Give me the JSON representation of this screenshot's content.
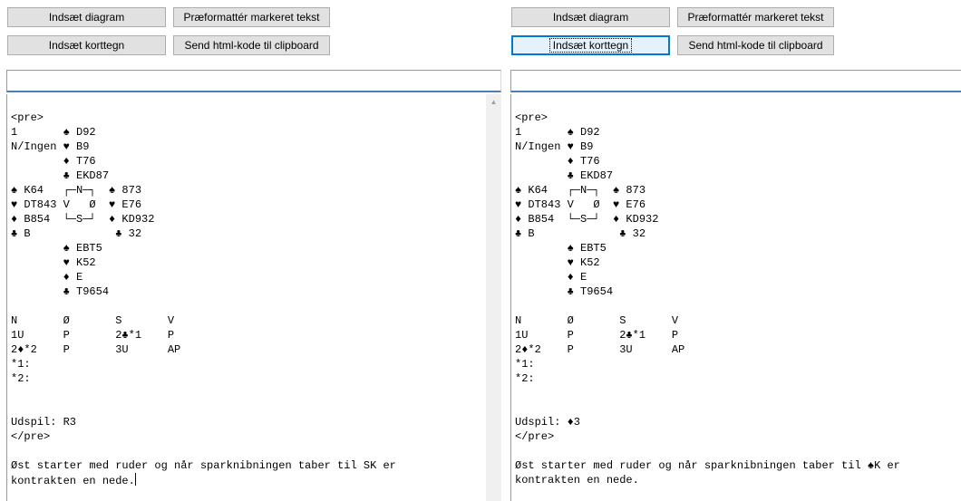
{
  "left": {
    "buttons": {
      "insert_diagram": "Indsæt diagram",
      "preformat_selected": "Præformattér markeret tekst",
      "insert_card_symbol": "Indsæt korttegn",
      "send_html": "Send html-kode til clipboard"
    },
    "input_value": "",
    "content": "<pre>\n1       ♠ D92\nN/Ingen ♥ B9\n        ♦ T76\n        ♣ EKD87\n♠ K64   ┌─N─┐  ♠ 873\n♥ DT843 V   Ø  ♥ E76\n♦ B854  └─S─┘  ♦ KD932\n♣ B             ♣ 32\n        ♠ EBT5\n        ♥ K52\n        ♦ E\n        ♣ T9654\n\nN       Ø       S       V\n1U      P       2♣*1    P\n2♦*2    P       3U      AP\n*1:\n*2:\n\n\nUdspil: R3\n</pre>\n\nØst starter med ruder og når sparknibningen taber til SK er\nkontrakten en nede."
  },
  "right": {
    "buttons": {
      "insert_diagram": "Indsæt diagram",
      "preformat_selected": "Præformattér markeret tekst",
      "insert_card_symbol": "Indsæt korttegn",
      "send_html": "Send html-kode til clipboard"
    },
    "input_value": "",
    "content": "<pre>\n1       ♠ D92\nN/Ingen ♥ B9\n        ♦ T76\n        ♣ EKD87\n♠ K64   ┌─N─┐  ♠ 873\n♥ DT843 V   Ø  ♥ E76\n♦ B854  └─S─┘  ♦ KD932\n♣ B             ♣ 32\n        ♠ EBT5\n        ♥ K52\n        ♦ E\n        ♣ T9654\n\nN       Ø       S       V\n1U      P       2♣*1    P\n2♦*2    P       3U      AP\n*1:\n*2:\n\n\nUdspil: ♦3\n</pre>\n\nØst starter med ruder og når sparknibningen taber til ♠K er\nkontrakten en nede."
  },
  "icons": {
    "scroll_up": "▲"
  }
}
